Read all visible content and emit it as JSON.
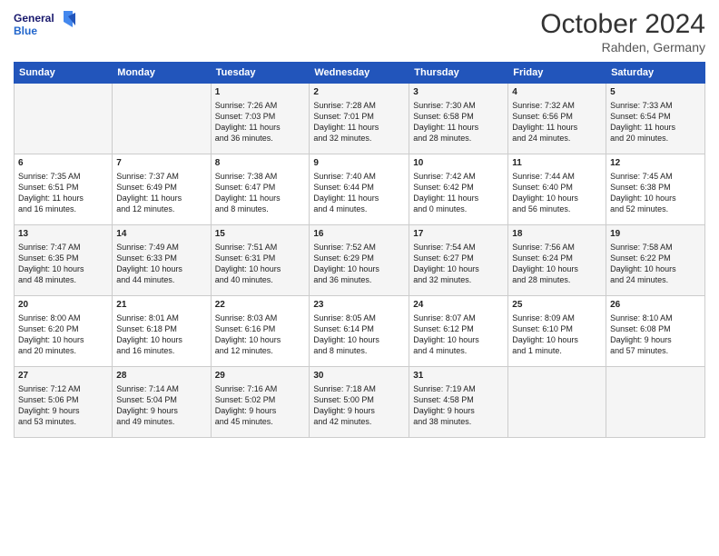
{
  "header": {
    "logo_line1": "General",
    "logo_line2": "Blue",
    "month": "October 2024",
    "location": "Rahden, Germany"
  },
  "weekdays": [
    "Sunday",
    "Monday",
    "Tuesday",
    "Wednesday",
    "Thursday",
    "Friday",
    "Saturday"
  ],
  "weeks": [
    [
      {
        "day": "",
        "content": ""
      },
      {
        "day": "",
        "content": ""
      },
      {
        "day": "1",
        "content": "Sunrise: 7:26 AM\nSunset: 7:03 PM\nDaylight: 11 hours\nand 36 minutes."
      },
      {
        "day": "2",
        "content": "Sunrise: 7:28 AM\nSunset: 7:01 PM\nDaylight: 11 hours\nand 32 minutes."
      },
      {
        "day": "3",
        "content": "Sunrise: 7:30 AM\nSunset: 6:58 PM\nDaylight: 11 hours\nand 28 minutes."
      },
      {
        "day": "4",
        "content": "Sunrise: 7:32 AM\nSunset: 6:56 PM\nDaylight: 11 hours\nand 24 minutes."
      },
      {
        "day": "5",
        "content": "Sunrise: 7:33 AM\nSunset: 6:54 PM\nDaylight: 11 hours\nand 20 minutes."
      }
    ],
    [
      {
        "day": "6",
        "content": "Sunrise: 7:35 AM\nSunset: 6:51 PM\nDaylight: 11 hours\nand 16 minutes."
      },
      {
        "day": "7",
        "content": "Sunrise: 7:37 AM\nSunset: 6:49 PM\nDaylight: 11 hours\nand 12 minutes."
      },
      {
        "day": "8",
        "content": "Sunrise: 7:38 AM\nSunset: 6:47 PM\nDaylight: 11 hours\nand 8 minutes."
      },
      {
        "day": "9",
        "content": "Sunrise: 7:40 AM\nSunset: 6:44 PM\nDaylight: 11 hours\nand 4 minutes."
      },
      {
        "day": "10",
        "content": "Sunrise: 7:42 AM\nSunset: 6:42 PM\nDaylight: 11 hours\nand 0 minutes."
      },
      {
        "day": "11",
        "content": "Sunrise: 7:44 AM\nSunset: 6:40 PM\nDaylight: 10 hours\nand 56 minutes."
      },
      {
        "day": "12",
        "content": "Sunrise: 7:45 AM\nSunset: 6:38 PM\nDaylight: 10 hours\nand 52 minutes."
      }
    ],
    [
      {
        "day": "13",
        "content": "Sunrise: 7:47 AM\nSunset: 6:35 PM\nDaylight: 10 hours\nand 48 minutes."
      },
      {
        "day": "14",
        "content": "Sunrise: 7:49 AM\nSunset: 6:33 PM\nDaylight: 10 hours\nand 44 minutes."
      },
      {
        "day": "15",
        "content": "Sunrise: 7:51 AM\nSunset: 6:31 PM\nDaylight: 10 hours\nand 40 minutes."
      },
      {
        "day": "16",
        "content": "Sunrise: 7:52 AM\nSunset: 6:29 PM\nDaylight: 10 hours\nand 36 minutes."
      },
      {
        "day": "17",
        "content": "Sunrise: 7:54 AM\nSunset: 6:27 PM\nDaylight: 10 hours\nand 32 minutes."
      },
      {
        "day": "18",
        "content": "Sunrise: 7:56 AM\nSunset: 6:24 PM\nDaylight: 10 hours\nand 28 minutes."
      },
      {
        "day": "19",
        "content": "Sunrise: 7:58 AM\nSunset: 6:22 PM\nDaylight: 10 hours\nand 24 minutes."
      }
    ],
    [
      {
        "day": "20",
        "content": "Sunrise: 8:00 AM\nSunset: 6:20 PM\nDaylight: 10 hours\nand 20 minutes."
      },
      {
        "day": "21",
        "content": "Sunrise: 8:01 AM\nSunset: 6:18 PM\nDaylight: 10 hours\nand 16 minutes."
      },
      {
        "day": "22",
        "content": "Sunrise: 8:03 AM\nSunset: 6:16 PM\nDaylight: 10 hours\nand 12 minutes."
      },
      {
        "day": "23",
        "content": "Sunrise: 8:05 AM\nSunset: 6:14 PM\nDaylight: 10 hours\nand 8 minutes."
      },
      {
        "day": "24",
        "content": "Sunrise: 8:07 AM\nSunset: 6:12 PM\nDaylight: 10 hours\nand 4 minutes."
      },
      {
        "day": "25",
        "content": "Sunrise: 8:09 AM\nSunset: 6:10 PM\nDaylight: 10 hours\nand 1 minute."
      },
      {
        "day": "26",
        "content": "Sunrise: 8:10 AM\nSunset: 6:08 PM\nDaylight: 9 hours\nand 57 minutes."
      }
    ],
    [
      {
        "day": "27",
        "content": "Sunrise: 7:12 AM\nSunset: 5:06 PM\nDaylight: 9 hours\nand 53 minutes."
      },
      {
        "day": "28",
        "content": "Sunrise: 7:14 AM\nSunset: 5:04 PM\nDaylight: 9 hours\nand 49 minutes."
      },
      {
        "day": "29",
        "content": "Sunrise: 7:16 AM\nSunset: 5:02 PM\nDaylight: 9 hours\nand 45 minutes."
      },
      {
        "day": "30",
        "content": "Sunrise: 7:18 AM\nSunset: 5:00 PM\nDaylight: 9 hours\nand 42 minutes."
      },
      {
        "day": "31",
        "content": "Sunrise: 7:19 AM\nSunset: 4:58 PM\nDaylight: 9 hours\nand 38 minutes."
      },
      {
        "day": "",
        "content": ""
      },
      {
        "day": "",
        "content": ""
      }
    ]
  ]
}
